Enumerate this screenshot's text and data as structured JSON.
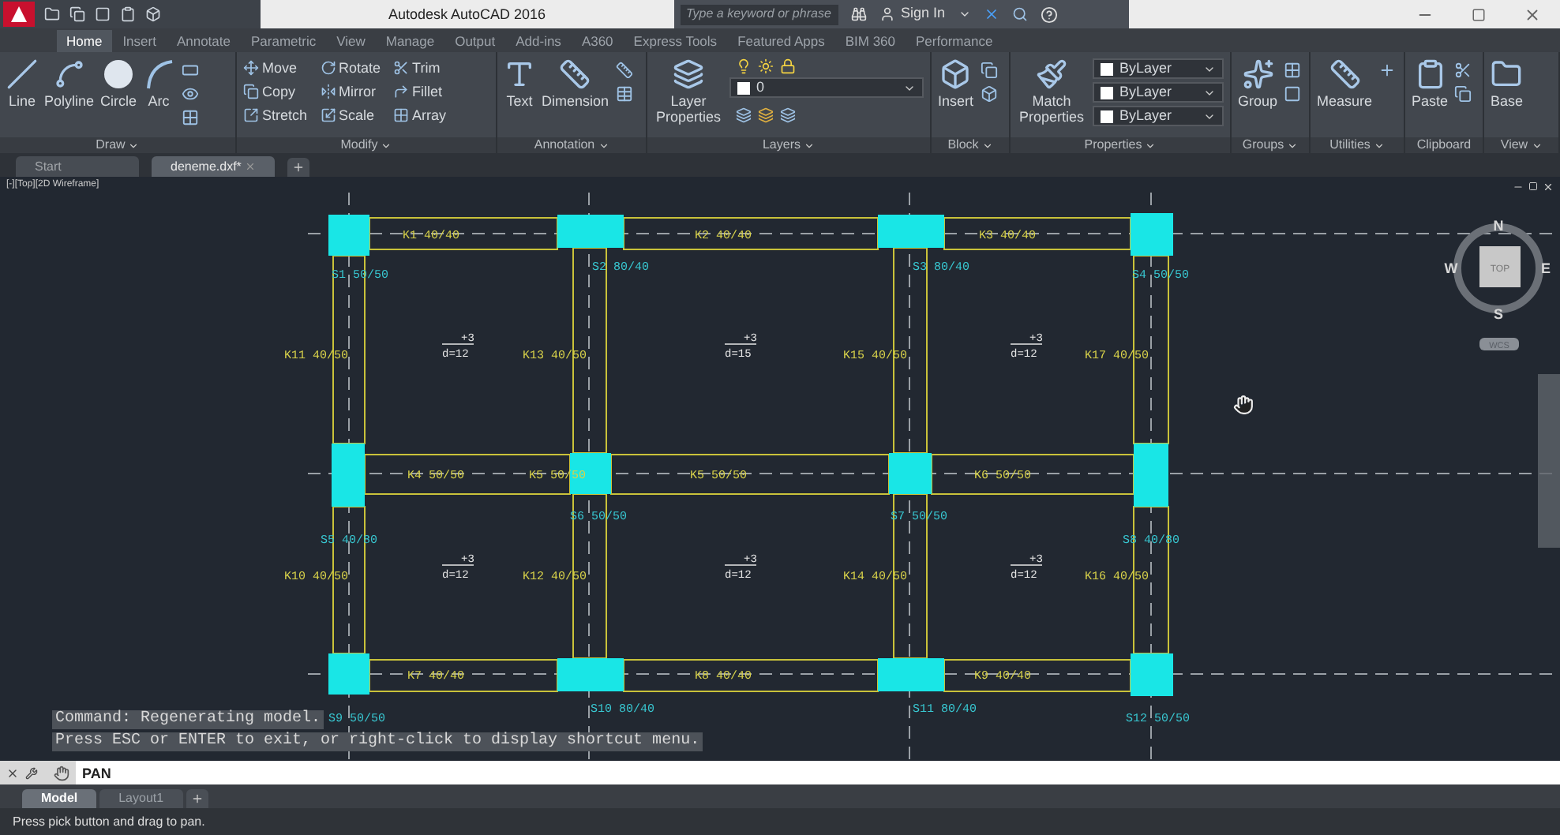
{
  "title_bar": {
    "title": "Autodesk AutoCAD 2016",
    "search": {
      "placeholder": "Type a keyword or phrase"
    },
    "sign_in": "Sign In"
  },
  "ribbon_tabs": [
    {
      "label": "Home",
      "selected": true
    },
    {
      "label": "Insert",
      "selected": false
    },
    {
      "label": "Annotate",
      "selected": false
    },
    {
      "label": "Parametric",
      "selected": false
    },
    {
      "label": "View",
      "selected": false
    },
    {
      "label": "Manage",
      "selected": false
    },
    {
      "label": "Output",
      "selected": false
    },
    {
      "label": "Add-ins",
      "selected": false
    },
    {
      "label": "A360",
      "selected": false
    },
    {
      "label": "Express Tools",
      "selected": false
    },
    {
      "label": "Featured Apps",
      "selected": false
    },
    {
      "label": "BIM 360",
      "selected": false
    },
    {
      "label": "Performance",
      "selected": false
    }
  ],
  "ribbon_panels": [
    {
      "title": "Draw",
      "menu": true,
      "large": [
        "Line",
        "Polyline",
        "Circle",
        "Arc"
      ]
    },
    {
      "title": "Modify",
      "menu": true,
      "small": [
        "Move",
        "Copy",
        "Stretch",
        "Rotate",
        "Mirror",
        "Scale",
        "Trim",
        "Fillet",
        "Array"
      ]
    },
    {
      "title": "Annotation",
      "menu": true,
      "large": [
        "Text",
        "Dimension"
      ]
    },
    {
      "title": "Layers",
      "menu": true,
      "large": [
        "Layer Properties"
      ],
      "dropdowns": [
        "0"
      ]
    },
    {
      "title": "Block",
      "menu": true,
      "large": [
        "Insert"
      ]
    },
    {
      "title": "Properties",
      "menu": true,
      "large": [
        "Match Properties"
      ],
      "dropdowns": [
        "ByLayer",
        "ByLayer",
        "ByLayer"
      ]
    },
    {
      "title": "Groups",
      "menu": true,
      "large": [
        "Group"
      ]
    },
    {
      "title": "Utilities",
      "menu": true,
      "large": [
        "Measure"
      ]
    },
    {
      "title": "Clipboard",
      "menu": false,
      "large": [
        "Paste"
      ]
    },
    {
      "title": "View",
      "menu": true,
      "large": [
        "Base"
      ]
    }
  ],
  "file_tabs": [
    {
      "label": "Start",
      "selected": false
    },
    {
      "label": "deneme.dxf*",
      "selected": true
    }
  ],
  "viewport": {
    "label": "[-][Top][2D Wireframe]"
  },
  "plan": {
    "beams": [
      "K1 40/40",
      "K2 40/40",
      "K3 40/40",
      "K11 40/50",
      "K13 40/50",
      "K15 40/50",
      "K17 40/50",
      "K4 50/50",
      "K5 50/50",
      "K5 50/50",
      "K6 50/50",
      "K10 40/50",
      "K12 40/50",
      "K14 40/50",
      "K16 40/50",
      "K7 40/40",
      "K8 40/40",
      "K9 40/40"
    ],
    "columns": [
      "S1 50/50",
      "S2 80/40",
      "S3 80/40",
      "S4 50/50",
      "S5 40/80",
      "S6 50/50",
      "S7 50/50",
      "S8 40/80",
      "S9 50/50",
      "S10 80/40",
      "S11 80/40",
      "S12 50/50"
    ],
    "slabs": [
      {
        "top": "+3",
        "bottom": "d=12"
      },
      {
        "top": "+3",
        "bottom": "d=15"
      },
      {
        "top": "+3",
        "bottom": "d=12"
      },
      {
        "top": "+3",
        "bottom": "d=12"
      },
      {
        "top": "+3",
        "bottom": "d=12"
      },
      {
        "top": "+3",
        "bottom": "d=12"
      }
    ]
  },
  "viewcube": {
    "north": "N",
    "west": "W",
    "east": "E",
    "south": "S",
    "face": "TOP",
    "ucs": "WCS"
  },
  "command_history": [
    "Command: Regenerating model.",
    "Press ESC or ENTER to exit, or right-click to display shortcut menu."
  ],
  "command_line": {
    "value": "PAN"
  },
  "layout_tabs": [
    {
      "label": "Model",
      "selected": true
    },
    {
      "label": "Layout1",
      "selected": false
    }
  ],
  "status_bar": "Press pick button and drag to pan."
}
